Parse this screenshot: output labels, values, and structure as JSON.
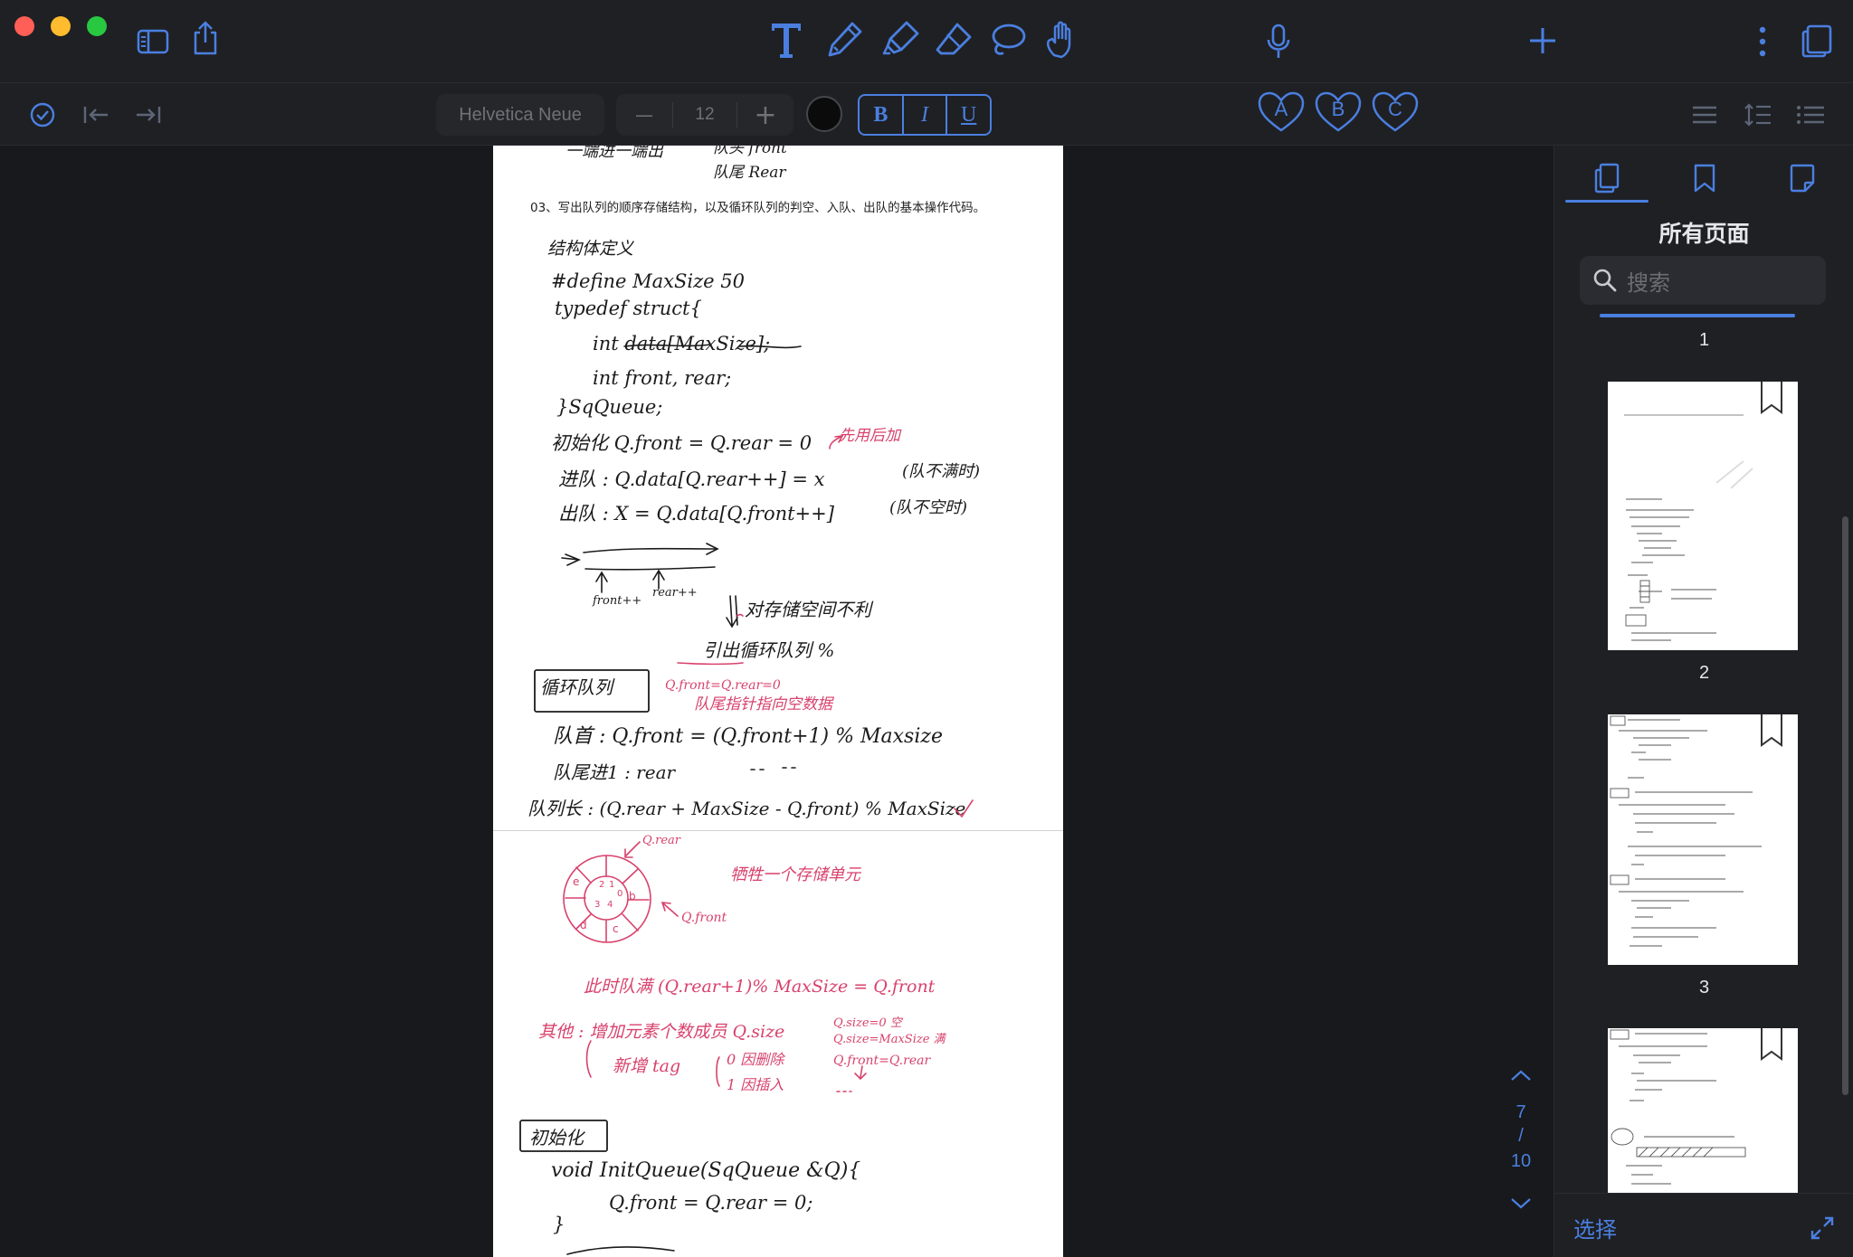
{
  "titlebar": {
    "tools": [
      "text-tool",
      "pen-tool",
      "highlighter-tool",
      "eraser-tool",
      "lasso-tool",
      "hand-tool"
    ]
  },
  "format": {
    "font": "Helvetica Neue",
    "size_minus": "—",
    "size": "12",
    "size_plus": "+",
    "bold": "B",
    "italic": "I",
    "underline": "U",
    "favorites": [
      "A",
      "B",
      "C"
    ]
  },
  "document": {
    "printed_question": "03、写出队列的顺序存储结构，以及循环队列的判空、入队、出队的基本操作代码。",
    "handwriting": {
      "top_fragment_1": "一端进一端出",
      "top_fragment_2": "队头 front",
      "top_fragment_3": "队尾 Rear",
      "l1": "结构体定义",
      "l2": "#define MaxSize 50",
      "l3": "typedef struct{",
      "l4": "int data[MaxSize];",
      "l5": "int front, rear;",
      "l6": "}SqQueue;",
      "l7": "初始化   Q.front = Q.rear = 0",
      "l7_note": "先用后加",
      "l8": "进队 :   Q.data[Q.rear++] = x",
      "l8_note": "(队不满时)",
      "l9": "出队 :   X = Q.data[Q.front++]",
      "l9_note": "(队不空时)",
      "diag_front": "front++",
      "diag_rear": "rear++",
      "l10": "对存储空间不利",
      "l11": "引出循环队列  %",
      "box1": "循环队列",
      "red1": "Q.front=Q.rear=0",
      "red2": "队尾指针指向空数据",
      "l12": "队首 :  Q.front = (Q.front+1) % Maxsize",
      "l13": "队尾进1 :  rear",
      "l14": "队列长 :  (Q.rear + MaxSize - Q.front) % MaxSize",
      "circle_rear": "Q.rear",
      "circle_front": "Q.front",
      "red3": "牺牲一个存储单元",
      "red4": "此时队满  (Q.rear+1)% MaxSize = Q.front",
      "red5": "其他 :  增加元素个数成员 Q.size",
      "red5b": "Q.size=0 空",
      "red5c": "Q.size=MaxSize 满",
      "red6": "新增 tag",
      "red6b": "0 因删除",
      "red6c": "Q.front=Q.rear",
      "red6d": "1 因插入",
      "box2": "初始化",
      "l15": "void  InitQueue(SqQueue &Q){",
      "l16": "Q.front = Q.rear = 0;",
      "l17": "}"
    }
  },
  "page_nav": {
    "current": "7",
    "slash": "/",
    "total": "10"
  },
  "sidebar": {
    "title": "所有页面",
    "search_placeholder": "搜索",
    "pages": [
      "1",
      "2",
      "3"
    ],
    "select": "选择"
  },
  "colors": {
    "accent": "#4a7fe0",
    "ink_black": "#1b1b1b",
    "ink_red": "#d8426c",
    "close": "#ff5f57",
    "minimize": "#febc2e",
    "zoom": "#28c840"
  }
}
